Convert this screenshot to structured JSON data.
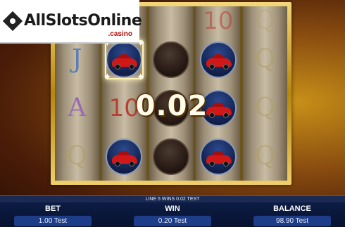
{
  "logo": {
    "text": "AllSlotsOnline",
    "sub": ".casino"
  },
  "win_overlay": "0.02",
  "reels": [
    [
      {
        "kind": "letter",
        "char": "J",
        "variant": "j"
      },
      {
        "kind": "letter",
        "char": "A",
        "variant": "a"
      },
      {
        "kind": "letter",
        "char": "Q",
        "variant": "q"
      }
    ],
    [
      {
        "kind": "car",
        "winning": true
      },
      {
        "kind": "letter",
        "char": "10",
        "variant": "ten"
      },
      {
        "kind": "car"
      }
    ],
    [
      {
        "kind": "coin"
      },
      {
        "kind": "coin"
      },
      {
        "kind": "coin"
      }
    ],
    [
      {
        "kind": "car"
      },
      {
        "kind": "car"
      },
      {
        "kind": "car"
      }
    ],
    [
      {
        "kind": "letter",
        "char": "Q",
        "variant": "q"
      },
      {
        "kind": "letter",
        "char": "Q",
        "variant": "q"
      },
      {
        "kind": "letter",
        "char": "Q",
        "variant": "q"
      }
    ]
  ],
  "top_row_partial": [
    {
      "char": ""
    },
    {
      "char": ""
    },
    {
      "char": ""
    },
    {
      "char": "10"
    },
    {
      "char": "Q"
    }
  ],
  "status": {
    "message": "LINE 5 WINS 0.02 TEST"
  },
  "panels": {
    "bet": {
      "label": "BET",
      "value": "1.00 Test"
    },
    "win": {
      "label": "WIN",
      "value": "0.20 Test"
    },
    "balance": {
      "label": "BALANCE",
      "value": "98.90 Test"
    }
  },
  "colors": {
    "frame_gold": "#d4a537",
    "panel_blue": "#1e3d88",
    "bar_navy": "#0c1c44"
  },
  "icons": [
    "sports-car-icon",
    "coin-icon",
    "sparkle-icon",
    "logo-diamond-icon"
  ]
}
